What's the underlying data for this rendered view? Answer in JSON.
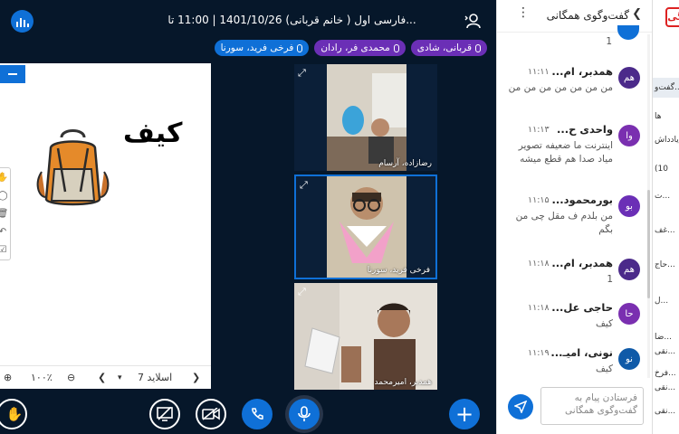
{
  "meeting": {
    "title": "فارسی اول ( خانم قربانی) 1401/10/26 | 11:00 تا..."
  },
  "talkers": [
    {
      "name": "قربانی، شادی",
      "color": "#6b2fb6"
    },
    {
      "name": "محمدی فر، رادان",
      "color": "#6b2fb6"
    },
    {
      "name": "فرخی فرید، سورنا",
      "color": "#0f70d7"
    }
  ],
  "presentation": {
    "slide_word": "کیف",
    "slide_label": "اسلاید 7",
    "zoom": "۱۰۰٪"
  },
  "videos": [
    {
      "name": "رضازاده، آرسام"
    },
    {
      "name": "فرخی فرید، سورنا"
    },
    {
      "name": "همدبر، امیرمحمد"
    }
  ],
  "chat": {
    "title": "گفت‌وگوی همگانی",
    "top_text": "1",
    "messages": [
      {
        "avatar": "هم",
        "color": "#4b2a8a",
        "sender": "همدبر، ام...",
        "time": "۱۱:۱۱",
        "text": "من من من من من من من"
      },
      {
        "avatar": "وا",
        "color": "#7a2fb0",
        "sender": "واحدی ح...",
        "time": "۱۱:۱۳",
        "text": "اینترنت ما ضعیفه تصویر میاد صدا هم قطع میشه"
      },
      {
        "avatar": "بو",
        "color": "#6b2fb6",
        "sender": "بورمحمود...",
        "time": "۱۱:۱۵",
        "text": "من بلدم ف مقل چی من بگم"
      },
      {
        "avatar": "هم",
        "color": "#4b2a8a",
        "sender": "همدبر، ام...",
        "time": "۱۱:۱۸",
        "text": "1"
      },
      {
        "avatar": "حا",
        "color": "#7a2fb0",
        "sender": "حاجی عل...",
        "time": "۱۱:۱۸",
        "text": "کیف"
      },
      {
        "avatar": "نو",
        "color": "#0f5aa8",
        "sender": "نونی، امیـ...",
        "time": "۱۱:۱۹",
        "text": "کیف"
      }
    ],
    "input_placeholder": "فرستادن پیام به گفت‌وگوی همگانی"
  },
  "sidebar_sliver": {
    "logo": "گی",
    "items": [
      "گفت‌و...",
      "ها",
      "یادداش...",
      "(10",
      "ت...",
      "غف...",
      "حاج...",
      "ل...",
      "ضا...",
      "نقی...",
      "فرخ...",
      "نقی...",
      "نقی..."
    ]
  }
}
